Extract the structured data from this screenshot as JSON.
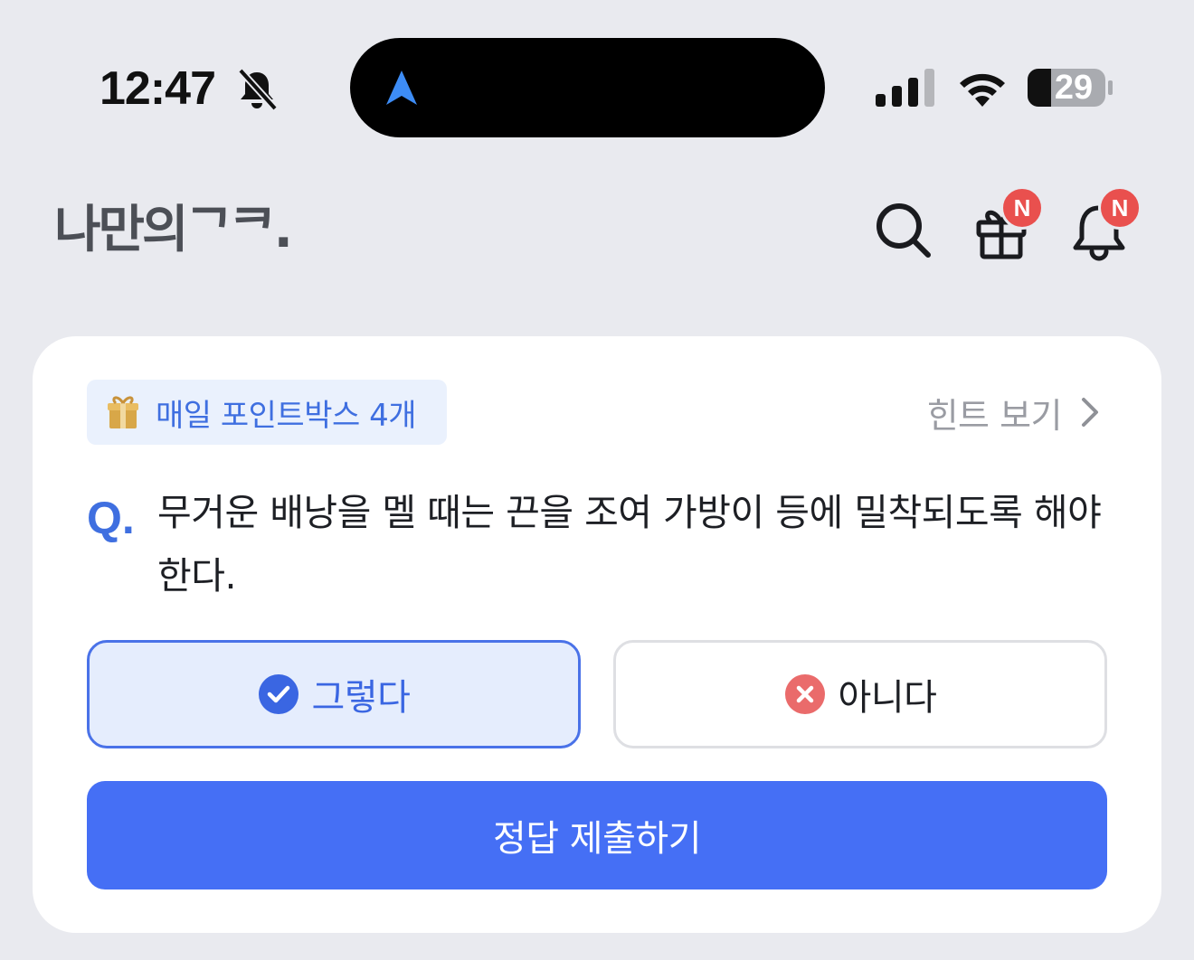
{
  "status_bar": {
    "time": "12:47",
    "battery": "29",
    "icons": [
      "bell-slash-icon",
      "navigation-arrow-icon",
      "cellular-signal-icon",
      "wifi-icon",
      "battery-icon"
    ]
  },
  "header": {
    "logo": "나만의ᄀᄏ.",
    "icons": [
      "search-icon",
      "gift-icon",
      "bell-icon"
    ],
    "gift_badge": "N",
    "bell_badge": "N"
  },
  "quiz": {
    "points_label": "매일 포인트박스 4개",
    "hint_label": "힌트 보기",
    "question_prefix": "Q.",
    "question": "무거운 배낭을 멜 때는 끈을 조여 가방이 등에 밀착되도록 해야 한다.",
    "options": [
      {
        "label": "그렇다",
        "icon": "check-circle-icon",
        "selected": true
      },
      {
        "label": "아니다",
        "icon": "x-circle-icon",
        "selected": false
      }
    ],
    "submit_label": "정답 제출하기"
  },
  "colors": {
    "background": "#e9eaef",
    "accent": "#456ff5",
    "badge": "#e9504e",
    "selected_bg": "#e5edfd"
  }
}
